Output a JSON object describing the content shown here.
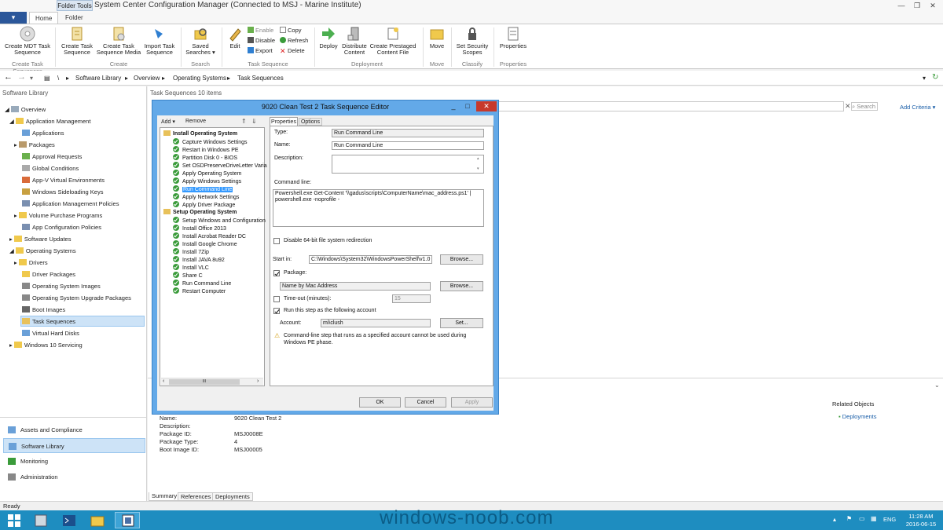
{
  "window": {
    "title": "System Center Configuration Manager (Connected to MSJ - Marine Institute)",
    "context_tab": "Folder Tools",
    "file_menu": "▾",
    "tabs": [
      "Home",
      "Folder"
    ]
  },
  "ribbon": {
    "create_mdt": "Create MDT Task Sequence",
    "create_ts": "Create Task Sequence",
    "create_ts_media": "Create Task Sequence Media",
    "import_ts": "Import Task Sequence",
    "saved_searches": "Saved Searches ▾",
    "edit": "Edit",
    "enable": "Enable",
    "disable": "Disable",
    "export": "Export",
    "copy": "Copy",
    "refresh": "Refresh",
    "delete": "Delete",
    "deploy": "Deploy",
    "distribute": "Distribute Content",
    "prestaged": "Create Prestaged Content File",
    "move": "Move",
    "set_security": "Set Security Scopes",
    "properties": "Properties",
    "groups": {
      "create_ts_group": "Create Task Sequences",
      "create": "Create",
      "search": "Search",
      "task_sequence": "Task Sequence",
      "deployment": "Deployment",
      "move": "Move",
      "classify": "Classify",
      "properties": "Properties"
    }
  },
  "breadcrumb": {
    "root": "\\",
    "items": [
      "Software Library",
      "Overview",
      "Operating Systems",
      "Task Sequences"
    ]
  },
  "left_pane": {
    "title": "Software Library",
    "tree": [
      "Overview",
      "Application Management",
      "Applications",
      "Packages",
      "Approval Requests",
      "Global Conditions",
      "App-V Virtual Environments",
      "Windows Sideloading Keys",
      "Application Management Policies",
      "Volume Purchase Programs",
      "App Configuration Policies",
      "Software Updates",
      "Operating Systems",
      "Drivers",
      "Driver Packages",
      "Operating System Images",
      "Operating System Upgrade Packages",
      "Boot Images",
      "Task Sequences",
      "Virtual Hard Disks",
      "Windows 10 Servicing"
    ],
    "workspaces": [
      "Assets and Compliance",
      "Software Library",
      "Monitoring",
      "Administration"
    ]
  },
  "right_pane": {
    "title": "Task Sequences 10 items",
    "search_placeholder": "Search",
    "add_criteria": "Add Criteria ▾",
    "related_objects": "Related Objects",
    "deployments_link": "Deployments",
    "details": [
      {
        "label": "Name:",
        "value": "9020 Clean Test 2"
      },
      {
        "label": "Description:",
        "value": ""
      },
      {
        "label": "Package ID:",
        "value": "MSJ0008E"
      },
      {
        "label": "Package Type:",
        "value": "4"
      },
      {
        "label": "Boot Image ID:",
        "value": "MSJ00005"
      }
    ],
    "bottom_tabs": [
      "Summary",
      "References",
      "Deployments"
    ]
  },
  "dialog": {
    "title": "9020 Clean Test 2 Task Sequence Editor",
    "add": "Add ▾",
    "remove": "Remove",
    "groups": [
      {
        "name": "Install Operating System",
        "steps": [
          "Capture Windows Settings",
          "Restart in Windows PE",
          "Partition Disk 0 - BIOS",
          "Set OSDPreserveDriveLetter Varia",
          "Apply Operating System",
          "Apply Windows Settings",
          "Run Command Line",
          "Apply Network Settings",
          "Apply Driver Package"
        ]
      },
      {
        "name": "Setup Operating System",
        "steps": [
          "Setup Windows and Configuration",
          "Install Office 2013",
          "Install Acrobat Reader DC",
          "Install Google Chrome",
          "Install 7Zip",
          "Install JAVA 8u92",
          "Install VLC",
          "Share C",
          "Run Command Line",
          "Restart Computer"
        ]
      }
    ],
    "scroll_mark": "III",
    "tabs": [
      "Properties",
      "Options"
    ],
    "type_label": "Type:",
    "type_value": "Run Command Line",
    "name_label": "Name:",
    "name_value": "Run Command Line",
    "desc_label": "Description:",
    "cmd_label": "Command line:",
    "cmd_value": "Powershell.exe Get-Content '\\\\gadus\\scripts\\ComputerName\\mac_address.ps1' | powershell.exe -noprofile -",
    "disable64": "Disable 64-bit file system redirection",
    "start_in_label": "Start in:",
    "start_in_value": "C:\\Windows\\System32\\WindowsPowerShell\\v1.0",
    "browse": "Browse...",
    "package_label": "Package:",
    "package_value": "Name by Mac Address",
    "timeout_label": "Time-out (minutes):",
    "timeout_value": "15",
    "run_as_label": "Run this step as the following account",
    "account_label": "Account:",
    "account_value": "mi\\clush",
    "set": "Set...",
    "warning": "Command-line step that runs as a specified account cannot be used during Windows PE phase.",
    "ok": "OK",
    "cancel": "Cancel",
    "apply": "Apply"
  },
  "status": "Ready",
  "taskbar": {
    "watermark": "windows-noob.com",
    "lang": "ENG",
    "time": "11:28 AM",
    "date": "2016-06-15"
  },
  "colors": {
    "accent": "#2b579a",
    "taskbar": "#1e8dc0",
    "dialog_frame": "#63a9e8",
    "link": "#1a5ea8"
  }
}
